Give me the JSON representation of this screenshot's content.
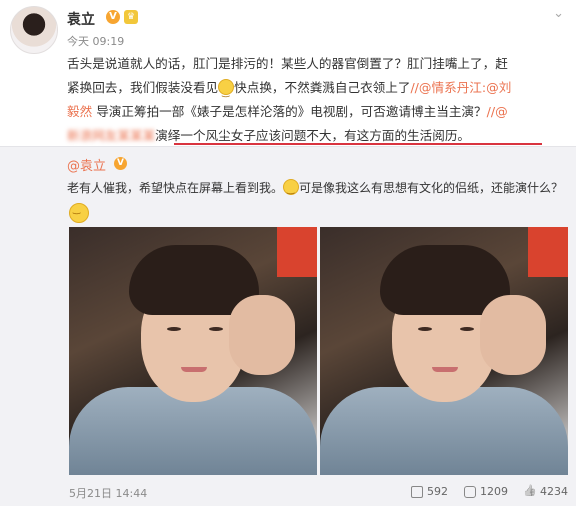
{
  "author": {
    "name": "袁立",
    "time": "今天 09:19"
  },
  "post": {
    "line1": "舌头是说道就人的话，肛门是排污的！某些人的器官倒置了？肛门挂嘴上了，赶",
    "line2a": "紧换回去，我们假装没看见",
    "line2b": "快点换，不然粪溅自己衣领上了",
    "mention1": "//@情系丹江:@刘",
    "line3_mention": "毅然",
    "line3": " 导演正筹拍一部《婊子是怎样沦落的》电视剧，可否邀请博主当主演？",
    "line3_tail": "//@",
    "line4_hidden": "新浪网友某某某",
    "line4": "演绎一个风尘女子应该问题不大，有这方面的生活阅历。"
  },
  "repost": {
    "name": "@袁立",
    "text_a": "老有人催我，希望快点在屏幕上看到我。",
    "text_b": "可是像我这么有思想有文化的侣纸，还能演什么？",
    "date": "5月21日 14:44",
    "stats": {
      "shares": "592",
      "comments": "1209",
      "likes": "4234"
    }
  },
  "colors": {
    "mention": "#eb7350",
    "underline": "#d9343f",
    "repost_bg": "#f2f2f5",
    "verified_badge": "#f7a531"
  },
  "icons": [
    "verified-v-icon",
    "vip-crown-icon",
    "chevron-down-icon",
    "smile-emoji-icon",
    "share-icon",
    "comment-icon",
    "like-icon"
  ]
}
